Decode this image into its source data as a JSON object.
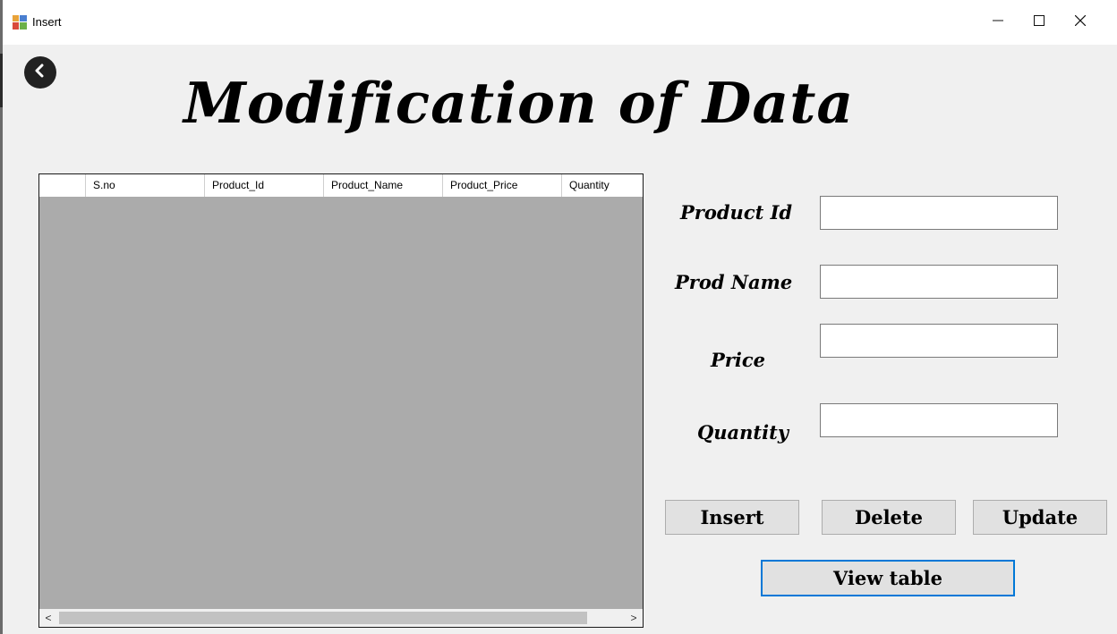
{
  "window": {
    "title": "Insert"
  },
  "heading": "Modification of Data",
  "grid": {
    "columns": [
      "",
      "S.no",
      "Product_Id",
      "Product_Name",
      "Product_Price",
      "Quantity"
    ],
    "scroll_left": "<",
    "scroll_right": ">"
  },
  "form": {
    "product_id": {
      "label": "Product Id",
      "value": ""
    },
    "prod_name": {
      "label": "Prod Name",
      "value": ""
    },
    "price": {
      "label": "Price",
      "value": ""
    },
    "quantity": {
      "label": "Quantity",
      "value": ""
    }
  },
  "buttons": {
    "insert": "Insert",
    "delete": "Delete",
    "update": "Update",
    "view_table": "View table"
  },
  "icons": {
    "app": "app-icon",
    "back": "back-arrow-icon",
    "minimize": "minimize-icon",
    "maximize": "maximize-icon",
    "close": "close-icon"
  },
  "colors": {
    "grid_background": "#ababab",
    "focus_border": "#0078d7"
  }
}
